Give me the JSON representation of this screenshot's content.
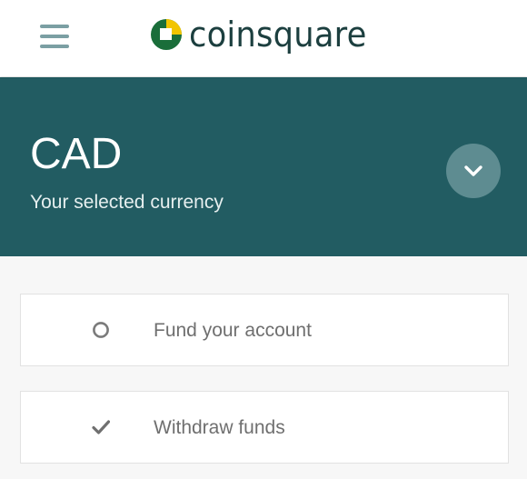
{
  "header": {
    "menu_icon": "hamburger-menu-icon",
    "logo_text": "coinsquare",
    "logo_icon": "coinsquare-logo-mark",
    "colors": {
      "logo_green": "#1a6e3a",
      "logo_yellow": "#f2c500",
      "logo_text": "#1c3f3f"
    }
  },
  "banner": {
    "currency_code": "CAD",
    "caption": "Your selected currency",
    "dropdown_icon": "chevron-down-icon",
    "colors": {
      "background": "#225c62",
      "dropdown_button": "#5e8c91"
    }
  },
  "options": [
    {
      "label": "Fund your account",
      "icon": "radio-circle-icon",
      "selected": false
    },
    {
      "label": "Withdraw funds",
      "icon": "checkmark-icon",
      "selected": true
    }
  ]
}
